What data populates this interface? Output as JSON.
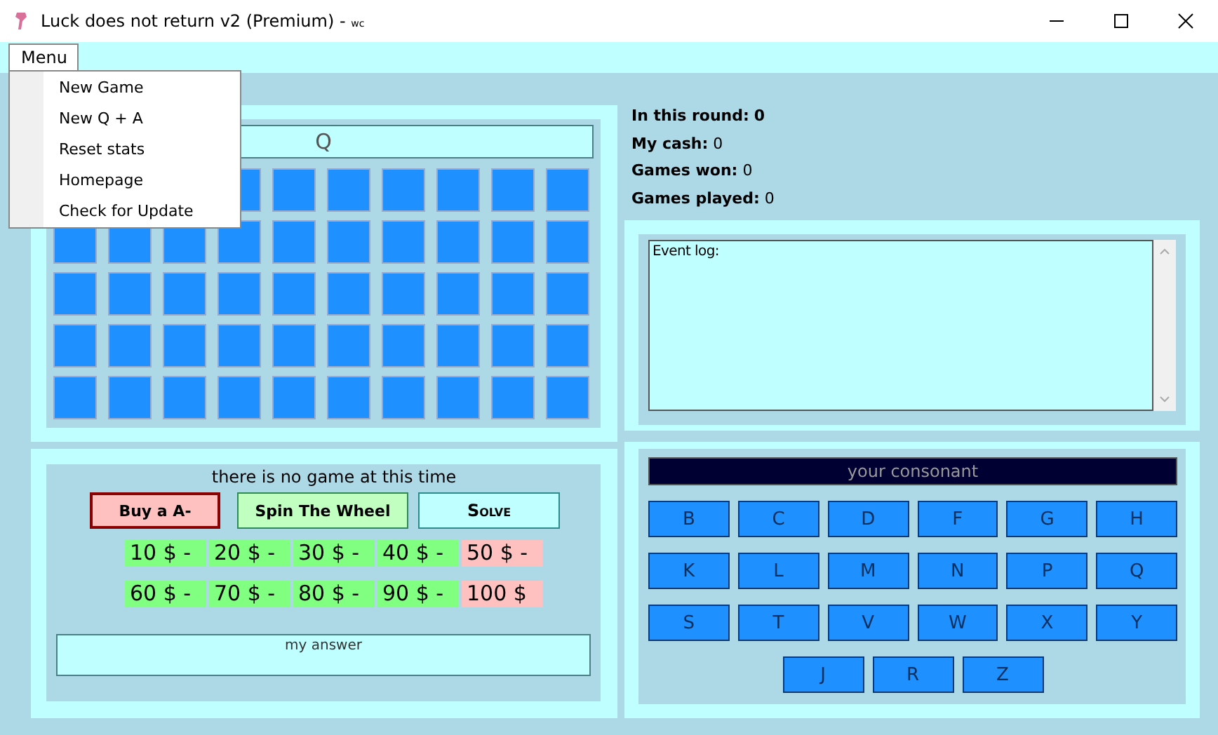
{
  "window": {
    "title": "Luck does not return v2 (Premium) -",
    "title_suffix": "wc"
  },
  "menubar": {
    "label": "Menu",
    "expanded": true,
    "items": [
      {
        "label": "New Game"
      },
      {
        "label": "New Q + A"
      },
      {
        "label": "Reset stats"
      },
      {
        "label": "Homepage"
      },
      {
        "label": "Check for Update"
      }
    ]
  },
  "board": {
    "hint": "Q"
  },
  "stats": [
    {
      "label": "In this round:",
      "value": "0",
      "value_bold": true
    },
    {
      "label": "My cash:",
      "value": "0",
      "value_bold": false
    },
    {
      "label": "Games won:",
      "value": "0",
      "value_bold": false
    },
    {
      "label": "Games played:",
      "value": "0",
      "value_bold": false
    }
  ],
  "event_log": {
    "value": "Event log:"
  },
  "game": {
    "status": "there is no game at this time",
    "buttons": [
      {
        "label": "Buy a A-",
        "kind": "buy"
      },
      {
        "label": "Spin The Wheel",
        "kind": "spin"
      },
      {
        "label": "Solve",
        "kind": "solve"
      }
    ],
    "prizes": [
      {
        "label": "10 $ -",
        "color": "#80ff80"
      },
      {
        "label": "20 $ -",
        "color": "#80ff80"
      },
      {
        "label": "30 $ -",
        "color": "#80ff80"
      },
      {
        "label": "40 $ -",
        "color": "#80ff80"
      },
      {
        "label": "50 $ -",
        "color": "#ffc0c0"
      },
      {
        "label": "60 $ -",
        "color": "#80ff80"
      },
      {
        "label": "70 $ -",
        "color": "#80ff80"
      },
      {
        "label": "80 $ -",
        "color": "#80ff80"
      },
      {
        "label": "90 $ -",
        "color": "#80ff80"
      },
      {
        "label": "100 $",
        "color": "#ffc0c0"
      }
    ],
    "answer": {
      "placeholder": "my answer"
    }
  },
  "consonants": {
    "title": "your consonant",
    "rows": [
      [
        "B",
        "C",
        "D",
        "F",
        "G",
        "H"
      ],
      [
        "K",
        "L",
        "M",
        "N",
        "P",
        "Q"
      ],
      [
        "S",
        "T",
        "V",
        "W",
        "X",
        "Y"
      ],
      [
        "J",
        "R",
        "Z"
      ]
    ]
  }
}
